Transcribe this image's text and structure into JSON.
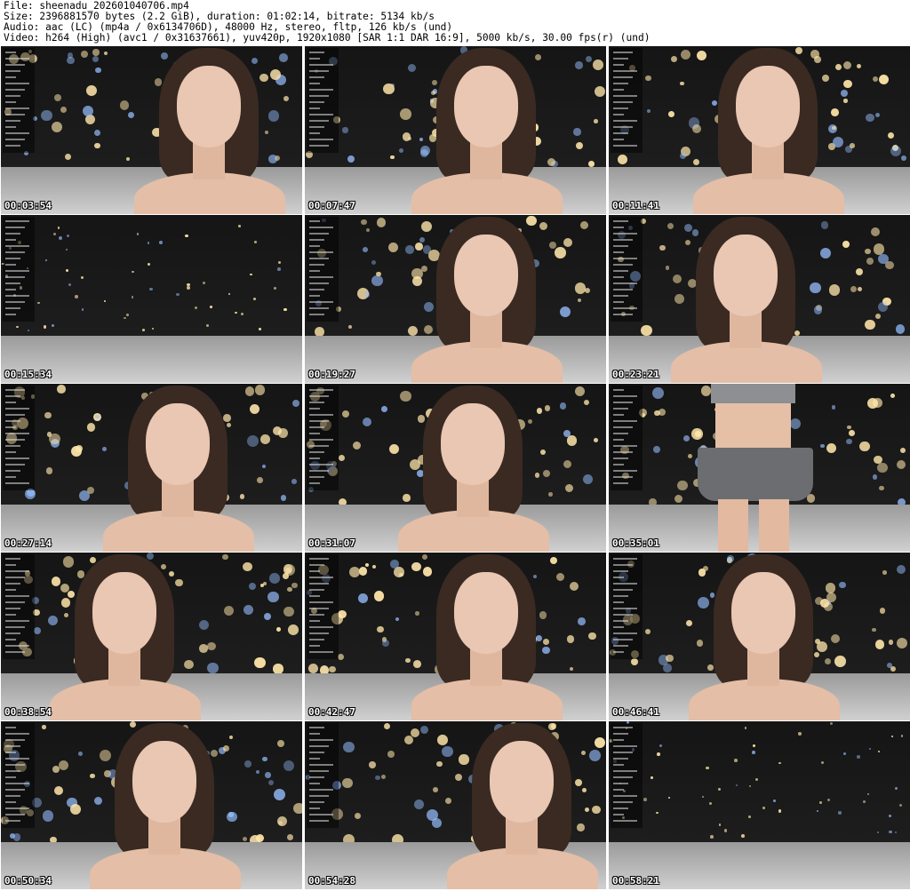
{
  "header": {
    "file_line": "File: sheenadu_202601040706.mp4",
    "size_line": "Size: 2396881570 bytes (2.2 GiB), duration: 01:02:14, bitrate: 5134 kb/s",
    "audio_line": "Audio: aac (LC) (mp4a / 0x6134706D), 48000 Hz, stereo, fltp, 126 kb/s (und)",
    "video_line": "Video: h264 (High) (avc1 / 0x31637661), yuv420p, 1920x1080 [SAR 1:1 DAR 16:9], 5000 kb/s, 30.00 fps(r) (und)"
  },
  "thumbnails": [
    {
      "timestamp": "00:03:54"
    },
    {
      "timestamp": "00:07:47"
    },
    {
      "timestamp": "00:11:41"
    },
    {
      "timestamp": "00:15:34"
    },
    {
      "timestamp": "00:19:27"
    },
    {
      "timestamp": "00:23:21"
    },
    {
      "timestamp": "00:27:14"
    },
    {
      "timestamp": "00:31:07"
    },
    {
      "timestamp": "00:35:01"
    },
    {
      "timestamp": "00:38:54"
    },
    {
      "timestamp": "00:42:47"
    },
    {
      "timestamp": "00:46:41"
    },
    {
      "timestamp": "00:50:34"
    },
    {
      "timestamp": "00:54:28"
    },
    {
      "timestamp": "00:58:21"
    }
  ]
}
